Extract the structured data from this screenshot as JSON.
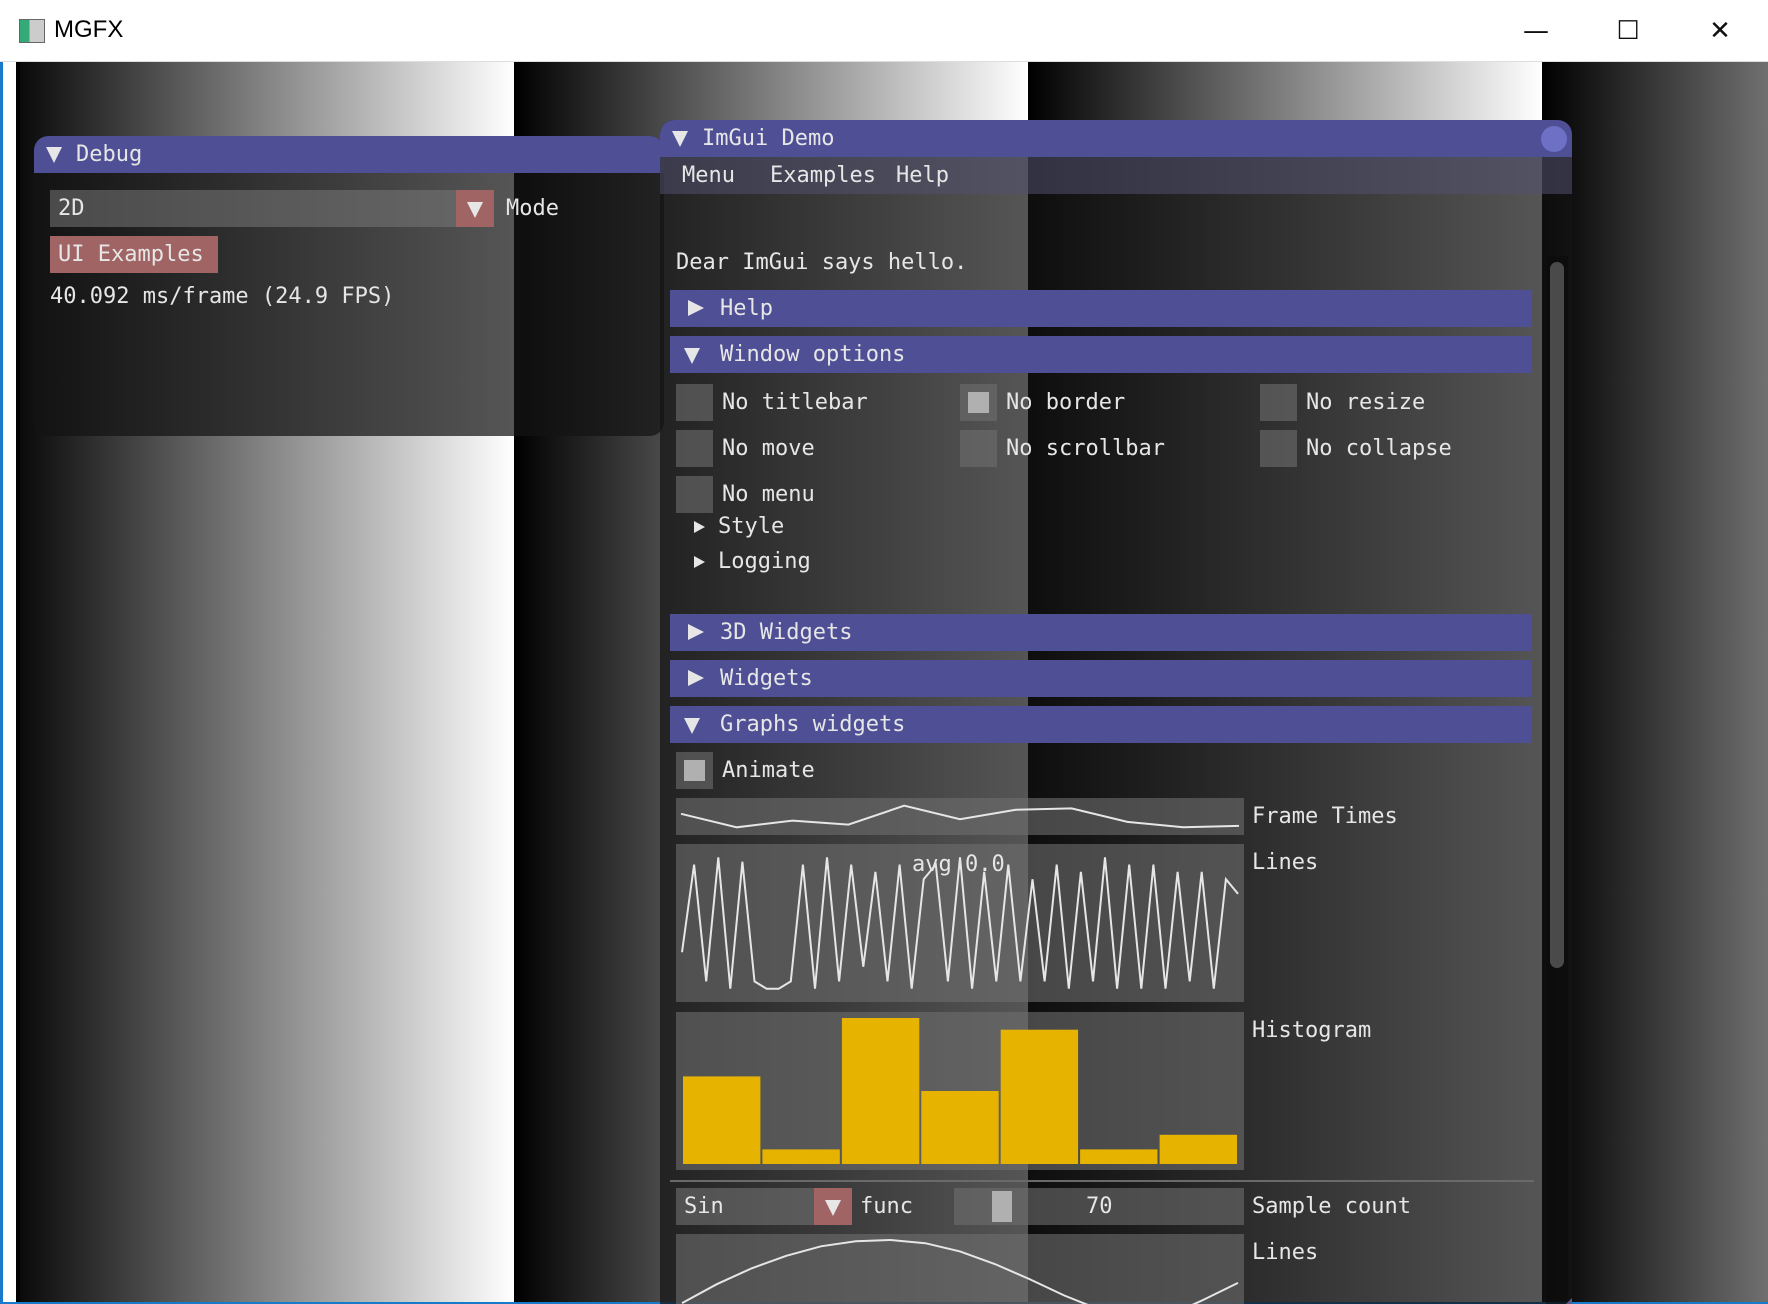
{
  "window": {
    "title": "MGFX",
    "minimize_glyph": "—",
    "maximize_glyph": "☐",
    "close_glyph": "✕"
  },
  "debug": {
    "title": "Debug",
    "mode_value": "2D",
    "mode_label": "Mode",
    "ui_examples_button": "UI Examples",
    "frame_stats": "40.092 ms/frame (24.9 FPS)"
  },
  "demo": {
    "title": "ImGui Demo",
    "menu": [
      "Menu",
      "Examples",
      "Help"
    ],
    "greeting": "Dear ImGui says hello.",
    "headers": {
      "help": "Help",
      "window_options": "Window options",
      "widgets_3d": "3D Widgets",
      "widgets": "Widgets",
      "graphs": "Graphs widgets"
    },
    "window_options": {
      "no_titlebar": "No titlebar",
      "no_border": "No border",
      "no_resize": "No resize",
      "no_move": "No move",
      "no_scrollbar": "No scrollbar",
      "no_collapse": "No collapse",
      "no_menu": "No menu",
      "no_border_checked": true,
      "style": "Style",
      "logging": "Logging"
    },
    "graphs": {
      "animate": "Animate",
      "animate_checked": true,
      "frame_times_label": "Frame Times",
      "lines_label": "Lines",
      "lines_overlay": "avg 0.0",
      "histogram_label": "Histogram",
      "func_value": "Sin",
      "func_label": "func",
      "sample_count_value": "70",
      "sample_count_label": "Sample count",
      "lines2_label": "Lines"
    }
  },
  "colors": {
    "title_bar": "#4e4f95",
    "histogram_bar": "#e6b400",
    "combo_button": "#a06464"
  },
  "chart_data": [
    {
      "type": "line",
      "name": "Frame Times",
      "values": [
        0.6,
        0.1,
        0.35,
        0.2,
        0.9,
        0.4,
        0.75,
        0.8,
        0.3,
        0.1,
        0.15
      ]
    },
    {
      "type": "line",
      "name": "Lines",
      "overlay": "avg 0.0",
      "values": [
        0.3,
        0.9,
        0.1,
        0.95,
        0.05,
        0.92,
        0.1,
        0.05,
        0.05,
        0.1,
        0.9,
        0.05,
        0.95,
        0.1,
        0.9,
        0.2,
        0.85,
        0.1,
        0.9,
        0.05,
        0.8,
        0.9,
        0.1,
        0.95,
        0.05,
        0.85,
        0.1,
        0.9,
        0.1,
        0.8,
        0.1,
        0.9,
        0.05,
        0.85,
        0.1,
        0.95,
        0.05,
        0.9,
        0.05,
        0.9,
        0.05,
        0.85,
        0.1,
        0.85,
        0.05,
        0.8,
        0.7
      ]
    },
    {
      "type": "bar",
      "name": "Histogram",
      "values": [
        0.6,
        0.1,
        1.0,
        0.5,
        0.92,
        0.1,
        0.2
      ],
      "ylim": [
        0,
        1.0
      ]
    },
    {
      "type": "line",
      "name": "Lines (Sin)",
      "values": [
        0.0,
        0.3,
        0.55,
        0.75,
        0.9,
        0.98,
        1.0,
        0.95,
        0.82,
        0.62,
        0.38,
        0.12,
        -0.1,
        -0.3,
        -0.2,
        0.05,
        0.32
      ]
    }
  ]
}
